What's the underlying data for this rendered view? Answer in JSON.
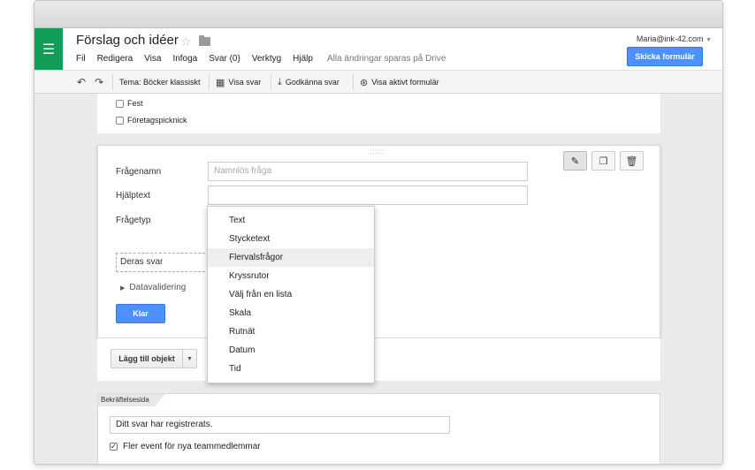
{
  "app": {
    "title": "Förslag och idéer",
    "account": "Maria@ink-42.com",
    "send_label": "Skicka formulär"
  },
  "menu": {
    "items": [
      "Fil",
      "Redigera",
      "Visa",
      "Infoga",
      "Svar (0)",
      "Verktyg",
      "Hjälp"
    ],
    "saved_status": "Alla ändringar sparas på Drive"
  },
  "toolbar": {
    "theme": "Tema: Böcker klassiskt",
    "view_responses": "Visa svar",
    "accept_responses": "Godkänna svar",
    "view_live": "Visa aktivt formulär"
  },
  "options_above": [
    "Fest",
    "Företagspicknick"
  ],
  "editor": {
    "question_label": "Frågenamn",
    "question_placeholder": "Namnlös fråga",
    "help_label": "Hjälptext",
    "help_value": "",
    "type_label": "Frågetyp",
    "answer_preview": "Deras svar",
    "validation_label": "Datavalidering",
    "done_label": "Klar"
  },
  "question_types": {
    "options": [
      "Text",
      "Stycketext",
      "Flervalsfrågor",
      "Kryssrutor",
      "Välj från en lista",
      "Skala",
      "Rutnät",
      "Datum",
      "Tid"
    ],
    "highlighted": "Flervalsfrågor"
  },
  "add_item": {
    "label": "Lägg till objekt"
  },
  "confirmation": {
    "tab_label": "Bekräftelsesida",
    "message": "Ditt svar har registrerats.",
    "checkbox_label": "Fler event för nya teammedlemmar",
    "checkbox_checked": true
  },
  "icons": {
    "menu": "grid-icon",
    "star": "star-icon",
    "folder": "folder-icon",
    "undo": "undo-icon",
    "redo": "redo-icon",
    "edit": "pencil-icon",
    "duplicate": "duplicate-icon",
    "delete": "trash-icon"
  },
  "colors": {
    "brand": "#0f9d58",
    "primary_button": "#4d90fe"
  }
}
